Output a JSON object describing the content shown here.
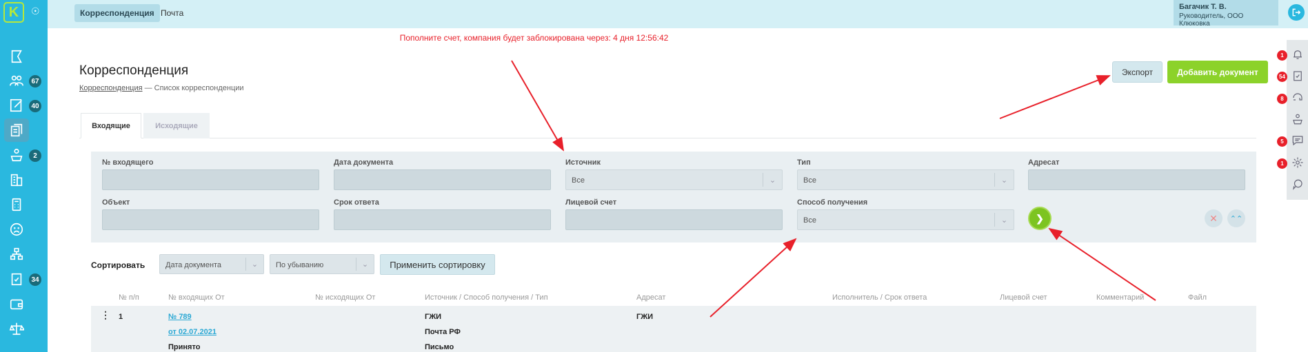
{
  "app": {
    "logo_text": "K",
    "top_tabs": [
      {
        "label": "Корреспонденция"
      },
      {
        "label": "Почта"
      }
    ],
    "user": {
      "name": "Багачик Т. В.",
      "role": "Руководитель, ООО Клюковка"
    }
  },
  "sidebar": {
    "badges": [
      "67",
      "40",
      "2",
      "34"
    ]
  },
  "warning": "Пополните счет, компания будет заблокирована через: 4 дня 12:56:42",
  "page": {
    "title": "Корреспонденция",
    "breadcrumb_link": "Корреспонденция",
    "breadcrumb_current": " — Список корреспонденции",
    "export_label": "Экспорт",
    "add_label": "Добавить документ"
  },
  "right_rail": {
    "badges": [
      "1",
      "54",
      "8",
      "5",
      "1"
    ]
  },
  "tabs": [
    {
      "label": "Входящие"
    },
    {
      "label": "Исходящие"
    }
  ],
  "filters": {
    "incoming_no": {
      "label": "№ входящего",
      "value": ""
    },
    "doc_date": {
      "label": "Дата документа",
      "value": ""
    },
    "source": {
      "label": "Источник",
      "value": "Все"
    },
    "type": {
      "label": "Тип",
      "value": "Все"
    },
    "addressee": {
      "label": "Адресат",
      "value": ""
    },
    "object": {
      "label": "Объект",
      "value": ""
    },
    "deadline": {
      "label": "Срок ответа",
      "value": ""
    },
    "account": {
      "label": "Лицевой счет",
      "value": ""
    },
    "receive_method": {
      "label": "Способ получения",
      "value": "Все"
    }
  },
  "sort": {
    "label": "Сортировать",
    "field": "Дата документа",
    "order": "По убыванию",
    "apply_label": "Применить сортировку"
  },
  "table": {
    "headers": [
      "№ п/п",
      "№ входящих От",
      "№ исходящих От",
      "Источник / Способ получения / Тип",
      "Адресат",
      "Исполнитель / Срок ответа",
      "Лицевой счет",
      "Комментарий",
      "Файл"
    ],
    "rows": [
      {
        "num": "1",
        "incoming_no": "№ 789",
        "incoming_date": "от 02.07.2021",
        "status": "Принято",
        "source": "ГЖИ",
        "method": "Почта РФ",
        "type": "Письмо",
        "addressee": "ГЖИ"
      }
    ]
  }
}
